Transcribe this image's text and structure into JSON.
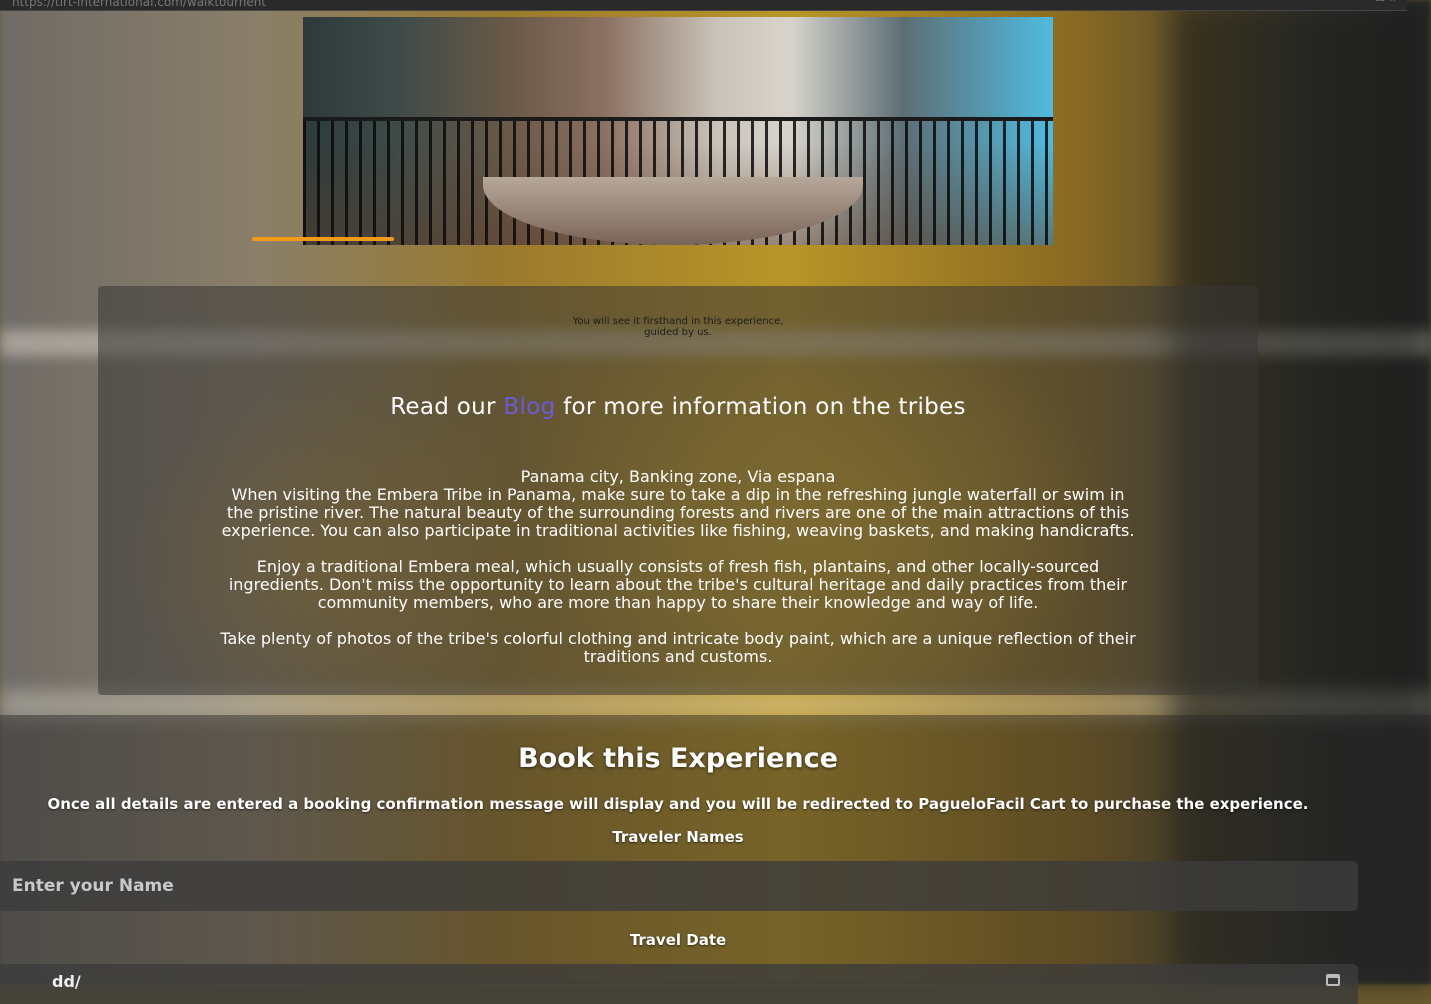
{
  "browser": {
    "url": "https://tlrt-international.com/walktournent"
  },
  "hero": {
    "image_alt": "colonial balcony with wrought-iron railing and plants",
    "carousel_progress": 0.19
  },
  "info": {
    "caption_line1": "You will see it firsthand in this experience,",
    "caption_line2": "guided by us.",
    "blog_prefix": "Read our",
    "blog_link": "Blog",
    "blog_suffix": "for more information on the tribes",
    "location": "Panama city, Banking zone, Via espana",
    "paragraph1": "When visiting the Embera Tribe in Panama, make sure to take a dip in the refreshing jungle waterfall or swim in the pristine river. The natural beauty of the surrounding forests and rivers are one of the main attractions of this experience. You can also participate in traditional activities like fishing, weaving baskets, and making handicrafts.",
    "paragraph2": "Enjoy a traditional Embera meal, which usually consists of fresh fish, plantains, and other locally-sourced ingredients. Don't miss the opportunity to learn about the tribe's cultural heritage and daily practices from their community members, who are more than happy to share their knowledge and way of life.",
    "paragraph3": "Take plenty of photos of the tribe's colorful clothing and intricate body paint, which are a unique reflection of their traditions and customs."
  },
  "booking": {
    "title": "Book this Experience",
    "note": "Once all details are entered a booking confirmation message will display and you will be redirected to PagueloFacil Cart to purchase the experience.",
    "names_label": "Traveler Names",
    "name_placeholder": "Enter your Name",
    "date_label": "Travel Date",
    "date_value": "dd/"
  },
  "colors": {
    "accent": "#f39a1b",
    "link": "#6b5bd6"
  }
}
